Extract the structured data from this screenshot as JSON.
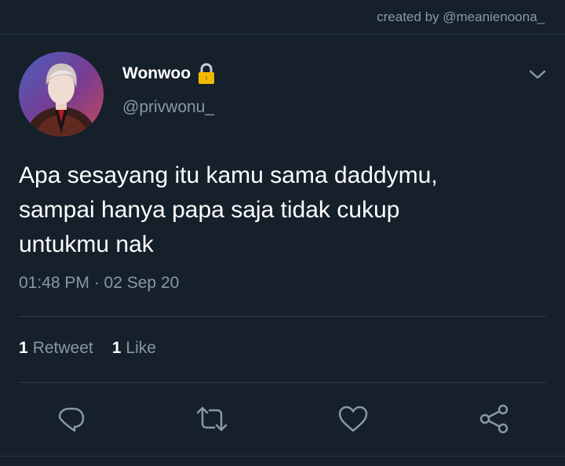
{
  "header": {
    "credit": "created by @meanienoona_"
  },
  "author": {
    "display_name": "Wonwoo",
    "handle": "@privwonu_",
    "avatar_icon": "profile-photo",
    "protected_icon": "lock-icon"
  },
  "tweet": {
    "lines": [
      "Apa sesayang itu kamu sama daddymu,",
      "sampai hanya papa saja tidak cukup",
      "untukmu nak"
    ],
    "timestamp": "01:48 PM · 02 Sep 20"
  },
  "stats": {
    "retweets_count": "1",
    "retweets_label": "Retweet",
    "likes_count": "1",
    "likes_label": "Like"
  },
  "actions": [
    "reply-icon",
    "retweet-icon",
    "like-icon",
    "share-icon"
  ],
  "colors": {
    "background": "#15202b",
    "secondary_text": "#8899a6",
    "divider": "#2c3946",
    "lock": "#f5b800"
  }
}
